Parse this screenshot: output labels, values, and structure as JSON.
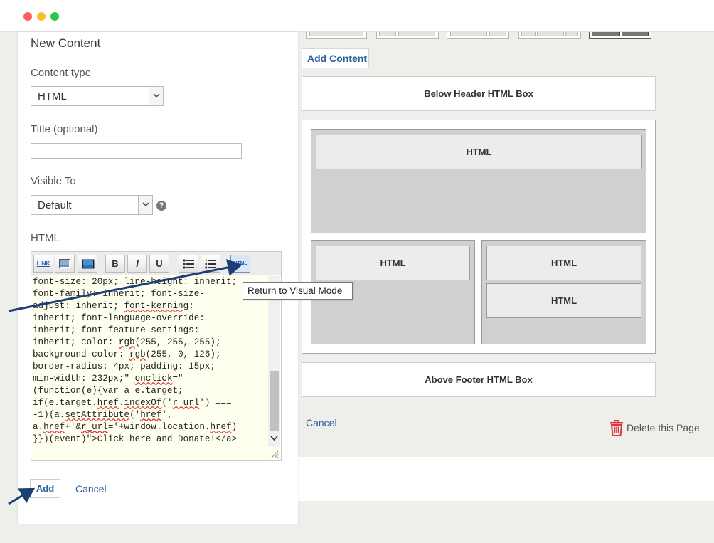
{
  "window": {
    "controls": [
      "close",
      "minimize",
      "maximize"
    ]
  },
  "left_panel": {
    "title": "New Content",
    "content_type": {
      "label": "Content type",
      "value": "HTML"
    },
    "title_field": {
      "label": "Title (optional)",
      "value": ""
    },
    "visible_to": {
      "label": "Visible To",
      "value": "Default",
      "help_icon": "?"
    },
    "html_editor": {
      "label": "HTML",
      "toolbar": {
        "link": "LINK",
        "image": "image-icon",
        "media": "media-icon",
        "bold": "B",
        "italic": "I",
        "underline": "U",
        "bullet_list": "bullet-list-icon",
        "numbered_list": "numbered-list-icon",
        "html": "HTML"
      },
      "code_lines": [
        "font-size: 20px; line-height: inherit;",
        "font-family: inherit; font-size-",
        "adjust: inherit; font-kerning:",
        "inherit; font-language-override:",
        "inherit; font-feature-settings:",
        "inherit; color: rgb(255, 255, 255);",
        "background-color: rgb(255, 0, 126);",
        "border-radius: 4px; padding: 15px;",
        "min-width: 232px;\" onclick=\"",
        "(function(e){var a=e.target;",
        "if(e.target.href.indexOf('r_url') ===",
        "-1){a.setAttribute('href',",
        "a.href+'&r_url='+window.location.href)",
        "}})(event)\">Click here and Donate!</a>"
      ]
    },
    "tooltip": "Return to Visual Mode",
    "add_button": "Add",
    "cancel_link": "Cancel"
  },
  "layout": {
    "add_content_tab": "Add Content",
    "below_header_box": "Below Header HTML Box",
    "blocks": [
      "HTML",
      "HTML",
      "HTML",
      "HTML"
    ],
    "above_footer_box": "Above Footer HTML Box",
    "cancel_link": "Cancel",
    "delete_page": "Delete this Page"
  },
  "colors": {
    "link_blue": "#2a5e9c",
    "annotation_arrow": "#1b3f73",
    "delete_red": "#d9393e"
  }
}
